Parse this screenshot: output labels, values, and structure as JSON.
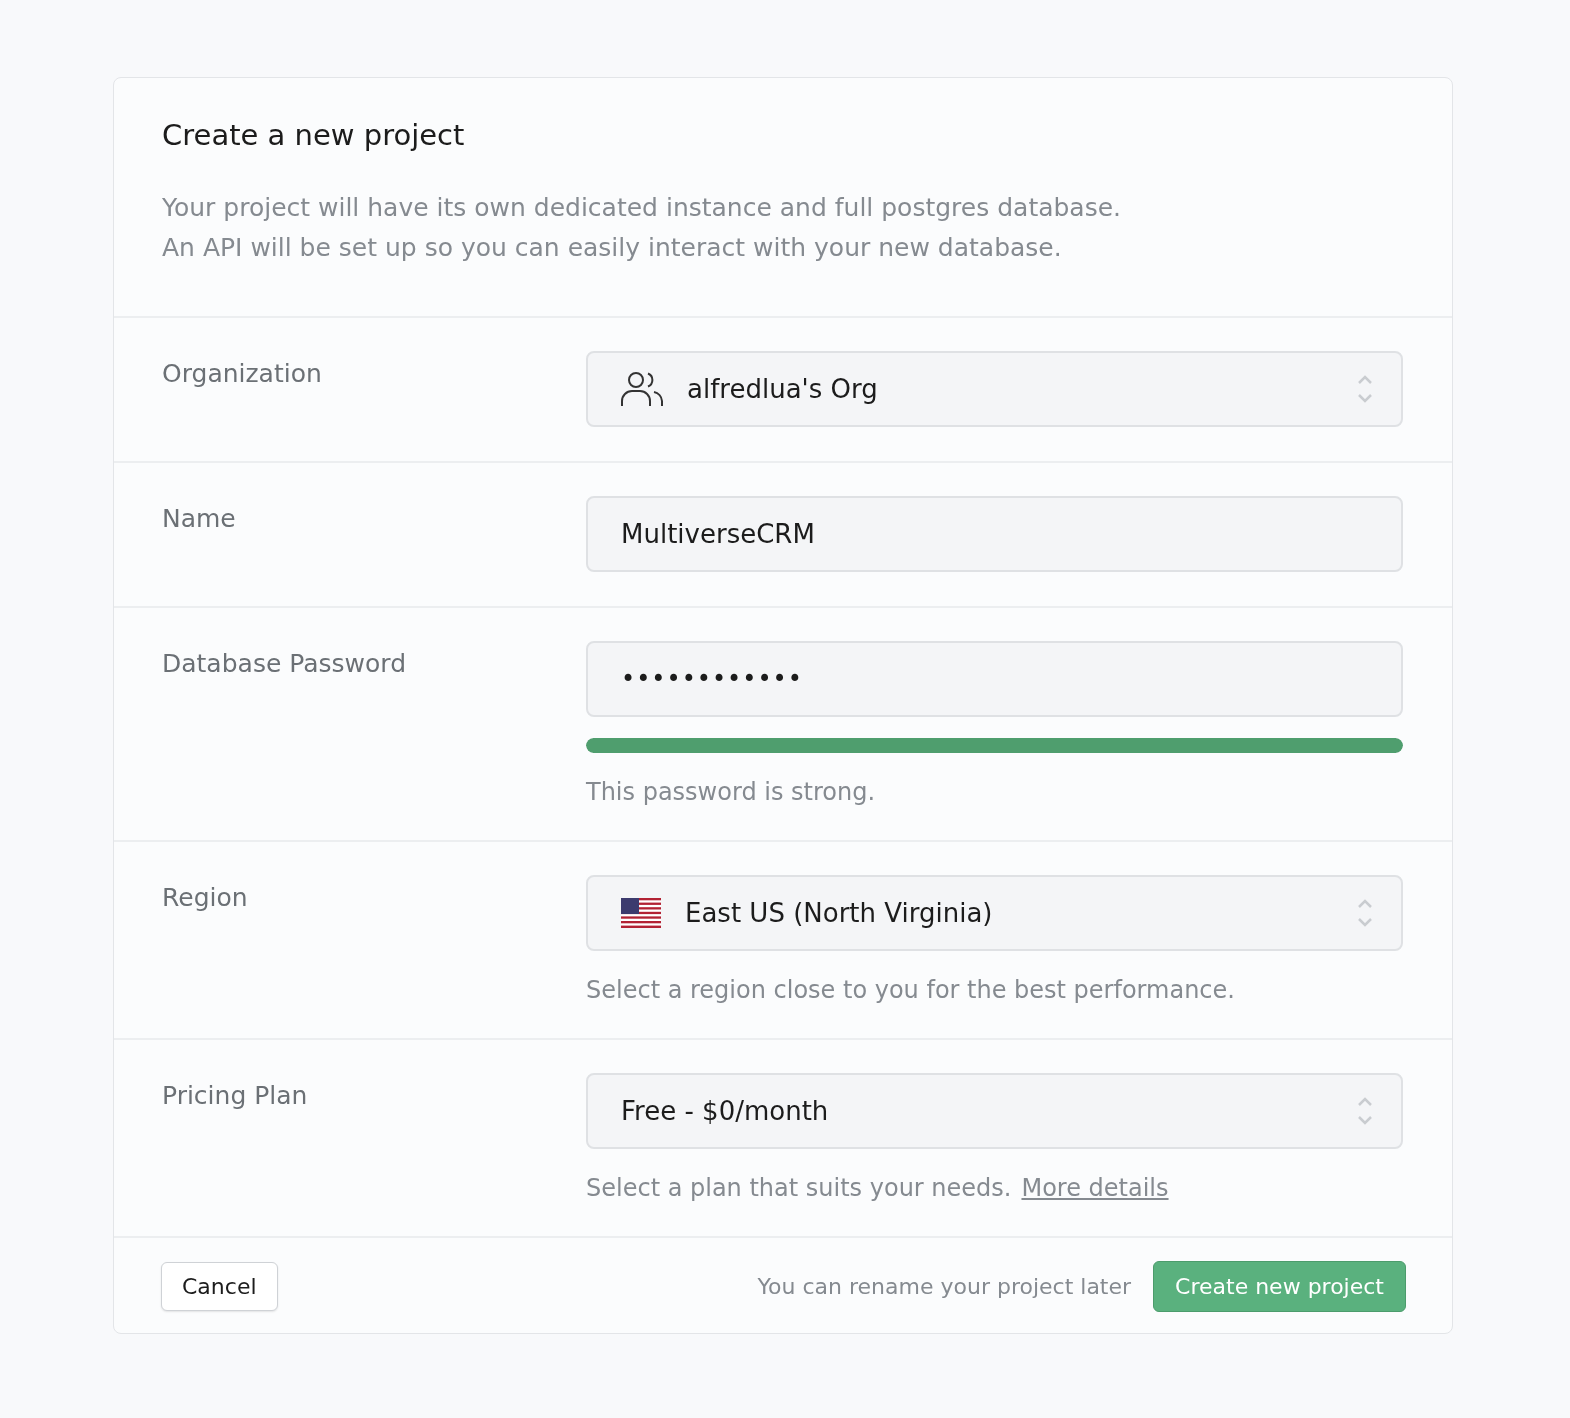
{
  "title": "Create a new project",
  "description": [
    "Your project will have its own dedicated instance and full postgres database.",
    "An API will be set up so you can easily interact with your new database."
  ],
  "fields": [
    {
      "kind": "team-select",
      "label": "Organization",
      "value": "alfredlua's Org"
    },
    {
      "kind": "text",
      "label": "Name",
      "value": "MultiverseCRM"
    },
    {
      "kind": "password",
      "label": "Database Password",
      "value": "••••••••••••",
      "level": 1,
      "hint": "This password is strong."
    },
    {
      "kind": "region-select",
      "label": "Region",
      "value": "East US (North Virginia)",
      "hint": "Select a region close to you for the best performance."
    },
    {
      "kind": "select",
      "label": "Pricing Plan",
      "value": "Free - $0/month",
      "hint": "Select a plan that suits your needs.",
      "link": "More details"
    }
  ],
  "footer": {
    "cancel": "Cancel",
    "note": "You can rename your project later",
    "submit": "Create new project"
  }
}
